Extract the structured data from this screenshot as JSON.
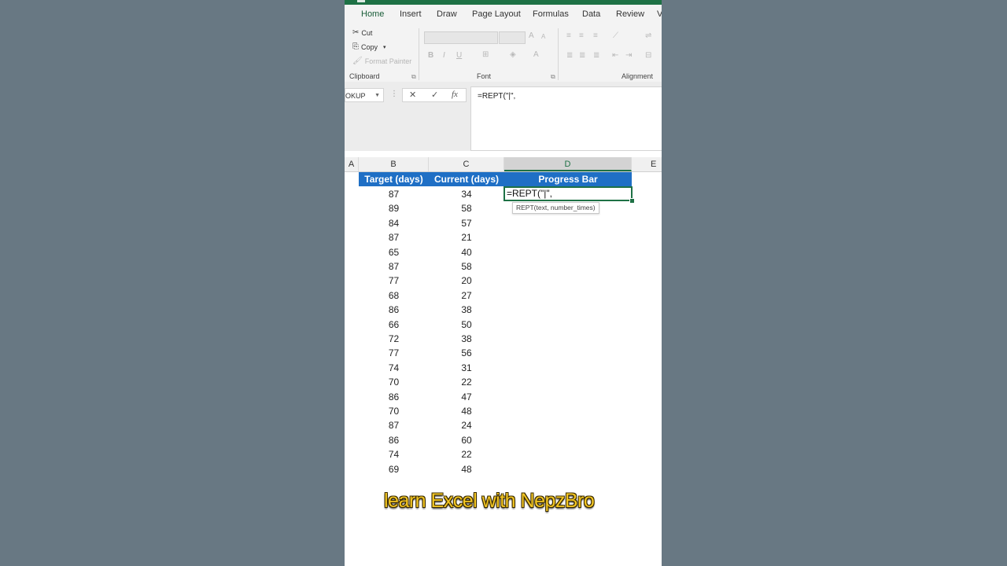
{
  "ribbon": {
    "tabs": [
      "Home",
      "Insert",
      "Draw",
      "Page Layout",
      "Formulas",
      "Data",
      "Review",
      "V"
    ],
    "active_tab": "Home",
    "clipboard": {
      "cut": "Cut",
      "copy": "Copy",
      "format_painter": "Format Painter",
      "label": "Clipboard"
    },
    "font": {
      "label": "Font",
      "bold": "B",
      "italic": "I",
      "underline": "U",
      "grow": "A",
      "shrink": "A"
    },
    "alignment": {
      "label": "Alignment"
    }
  },
  "formula_bar": {
    "name_box": "OKUP",
    "cancel": "✕",
    "enter": "✓",
    "fx": "fx",
    "formula": "=REPT(\"|\","
  },
  "grid": {
    "columns": [
      "A",
      "B",
      "C",
      "D",
      "E"
    ],
    "selected_column": "D",
    "headers": {
      "target": "Target (days)",
      "current": "Current (days)",
      "progress": "Progress Bar"
    },
    "active_cell_text": "=REPT(\"|\",",
    "tooltip": "REPT(text, number_times)",
    "rows": [
      {
        "target": "87",
        "current": "34"
      },
      {
        "target": "89",
        "current": "58"
      },
      {
        "target": "84",
        "current": "57"
      },
      {
        "target": "87",
        "current": "21"
      },
      {
        "target": "65",
        "current": "40"
      },
      {
        "target": "87",
        "current": "58"
      },
      {
        "target": "77",
        "current": "20"
      },
      {
        "target": "68",
        "current": "27"
      },
      {
        "target": "86",
        "current": "38"
      },
      {
        "target": "66",
        "current": "50"
      },
      {
        "target": "72",
        "current": "38"
      },
      {
        "target": "77",
        "current": "56"
      },
      {
        "target": "74",
        "current": "31"
      },
      {
        "target": "70",
        "current": "22"
      },
      {
        "target": "86",
        "current": "47"
      },
      {
        "target": "70",
        "current": "48"
      },
      {
        "target": "87",
        "current": "24"
      },
      {
        "target": "86",
        "current": "60"
      },
      {
        "target": "74",
        "current": "22"
      },
      {
        "target": "69",
        "current": "48"
      }
    ]
  },
  "watermark": "learn Excel with NepzBro",
  "colors": {
    "excel_green": "#1e7145",
    "header_blue": "#1f6fc5",
    "background": "#687883",
    "watermark_yellow": "#f3c623"
  }
}
